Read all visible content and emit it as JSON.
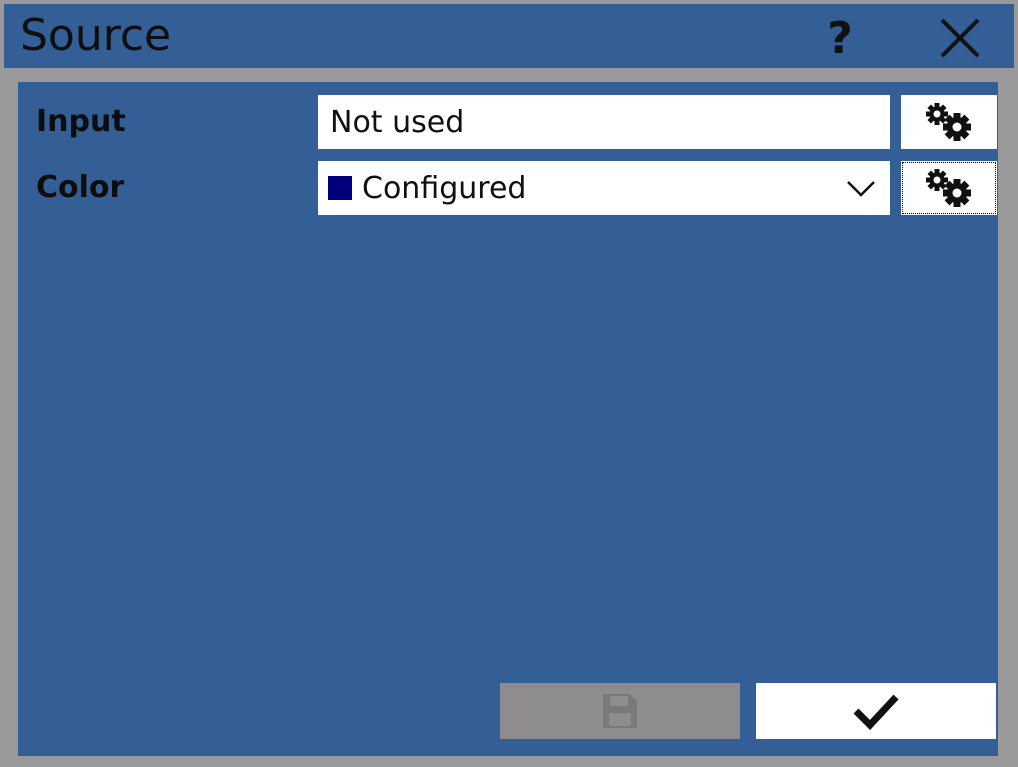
{
  "window": {
    "title": "Source",
    "help_label": "?",
    "help_icon": "question-icon",
    "close_icon": "close-icon"
  },
  "form": {
    "input": {
      "label": "Input",
      "value": "Not used",
      "settings_icon": "gears-icon"
    },
    "color": {
      "label": "Color",
      "value": "Configured",
      "swatch_color": "#00007a",
      "dropdown_icon": "chevron-down-icon",
      "settings_icon": "gears-icon"
    }
  },
  "footer": {
    "save_icon": "floppy-disk-icon",
    "save_enabled": false,
    "ok_icon": "checkmark-icon"
  },
  "colors": {
    "background": "#335e96",
    "frame": "#9a9a9a",
    "disabled_button": "#8e8c8e"
  }
}
